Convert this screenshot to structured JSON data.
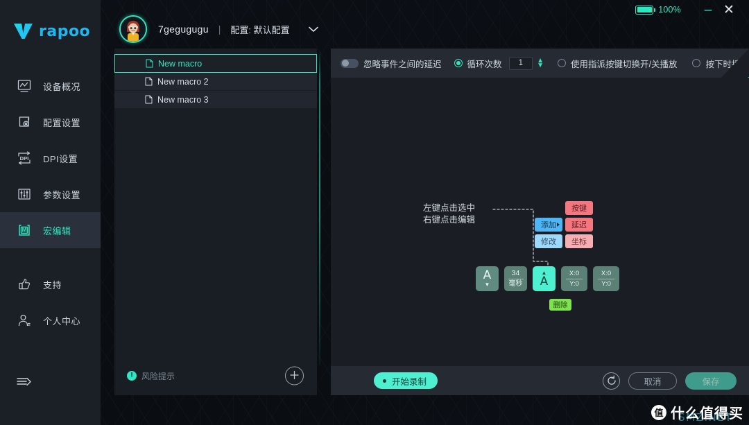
{
  "titlebar": {
    "battery_label": "100%",
    "battery_icon": "battery-full-icon",
    "minimize_label": "–",
    "close_label": "✕"
  },
  "brand": {
    "logo_text": "rapoo",
    "logo_icon": "rapoo-v-logo"
  },
  "sidebar": {
    "items": [
      {
        "label": "设备概况",
        "icon": "device-overview-icon",
        "active": false
      },
      {
        "label": "配置设置",
        "icon": "config-settings-icon",
        "active": false
      },
      {
        "label": "DPI设置",
        "icon": "dpi-settings-icon",
        "active": false
      },
      {
        "label": "参数设置",
        "icon": "parameter-settings-icon",
        "active": false
      },
      {
        "label": "宏编辑",
        "icon": "macro-editor-icon",
        "active": true
      },
      {
        "label": "支持",
        "icon": "thumbs-up-icon",
        "active": false
      },
      {
        "label": "个人中心",
        "icon": "user-profile-icon",
        "active": false
      }
    ],
    "collapse_icon": "collapse-menu-icon"
  },
  "header": {
    "avatar": "user-avatar",
    "username": "7gegugugu",
    "separator": "|",
    "config_label": "配置: 默认配置",
    "caret_icon": "chevron-down-icon"
  },
  "macro_list": {
    "items": [
      {
        "name": "New macro",
        "selected": true
      },
      {
        "name": "New macro 2",
        "selected": false
      },
      {
        "name": "New macro 3",
        "selected": false
      }
    ],
    "risk_label": "风险提示",
    "risk_icon": "warning-icon",
    "add_label": "+",
    "add_icon": "add-macro-icon"
  },
  "toolbar": {
    "ignore_delay_label": "忽略事件之间的延迟",
    "ignore_delay_on": false,
    "loop_count_label": "循环次数",
    "loop_count_value": "1",
    "loop_count_selected": true,
    "toggle_playback_label": "使用指派按键切换开/关播放",
    "toggle_playback_selected": false,
    "press_play_label": "按下时播放",
    "press_play_selected": false
  },
  "canvas": {
    "hint_line1": "左键点击选中",
    "hint_line2": "右键点击编辑",
    "context_menu": [
      {
        "label": "添加",
        "has_submenu": true
      },
      {
        "label": "修改",
        "has_submenu": false
      }
    ],
    "submenu": [
      {
        "label": "按键"
      },
      {
        "label": "延迟"
      },
      {
        "label": "坐标"
      }
    ],
    "events": [
      {
        "type": "key-up",
        "main": "A",
        "sub": "▼",
        "selected": false
      },
      {
        "type": "delay",
        "main": "34",
        "sub": "毫秒",
        "selected": false
      },
      {
        "type": "key-down",
        "main": "A",
        "sub": "▲",
        "selected": true
      },
      {
        "type": "coordinate",
        "main": "X:0",
        "sub": "Y:0",
        "selected": false
      },
      {
        "type": "coordinate",
        "main": "X:0",
        "sub": "Y:0",
        "selected": false
      }
    ],
    "delete_label": "删除"
  },
  "bottombar": {
    "record_label": "开始录制",
    "refresh_icon": "refresh-icon",
    "cancel_label": "取消",
    "save_label": "保存"
  },
  "watermark": {
    "badge": "值",
    "text": "什么值得买",
    "sub": "SMZ.NET"
  },
  "colors": {
    "accent": "#2ee6c0",
    "brand_blue": "#20b7f0",
    "sidebar_bg": "#1b1f26",
    "panel_bg": "#1a1e24",
    "toolbar_bg": "#252a33",
    "danger": "#f4767f",
    "info": "#4eb6f5",
    "success": "#7fe34e"
  }
}
